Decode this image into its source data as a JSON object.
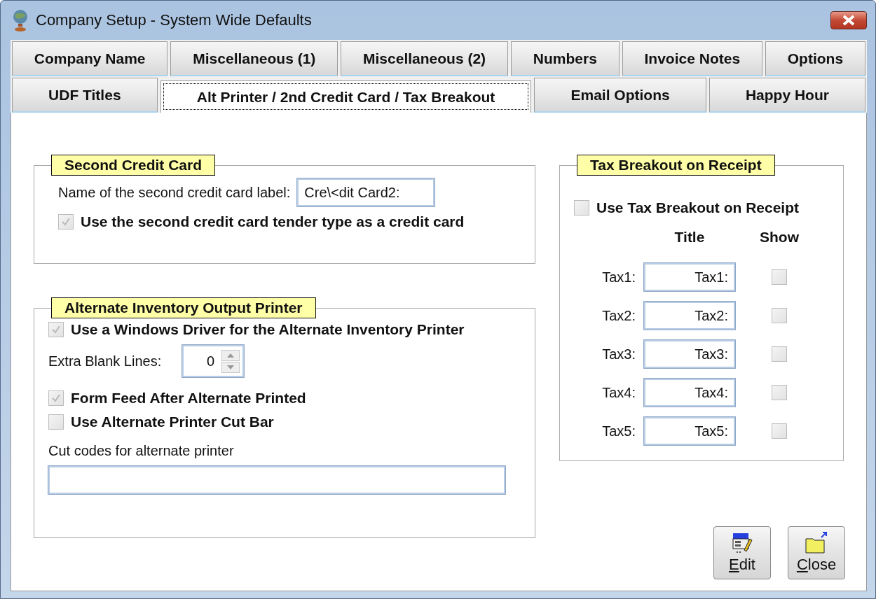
{
  "window": {
    "title": "Company Setup - System Wide Defaults"
  },
  "tab_rows": [
    {
      "tabs": [
        {
          "label": "Company Name",
          "selected": false
        },
        {
          "label": "Miscellaneous (1)",
          "selected": false
        },
        {
          "label": "Miscellaneous (2)",
          "selected": false
        },
        {
          "label": "Numbers",
          "selected": false
        },
        {
          "label": "Invoice Notes",
          "selected": false
        },
        {
          "label": "Options",
          "selected": false
        }
      ]
    },
    {
      "tabs": [
        {
          "label": "UDF Titles",
          "selected": false
        },
        {
          "label": "Alt Printer / 2nd Credit Card / Tax Breakout",
          "selected": true
        },
        {
          "label": "Email Options",
          "selected": false
        },
        {
          "label": "Happy Hour",
          "selected": false
        }
      ]
    }
  ],
  "second_credit_card": {
    "title": "Second Credit Card",
    "label_field": {
      "label": "Name of the second credit card label:",
      "value": "Cre\\<dit Card2:"
    },
    "use_as_credit": {
      "label": "Use the second credit card tender type as a credit card",
      "checked": true
    }
  },
  "alternate_printer": {
    "title": "Alternate Inventory Output Printer",
    "windows_driver": {
      "label": "Use a Windows Driver for the Alternate Inventory Printer",
      "checked": true
    },
    "extra_blank_lines": {
      "label": "Extra Blank Lines:",
      "value": "0"
    },
    "form_feed": {
      "label": "Form Feed After Alternate Printed",
      "checked": true
    },
    "cut_bar": {
      "label": "Use Alternate Printer Cut Bar",
      "checked": false
    },
    "cut_codes": {
      "label": "Cut codes for alternate printer"
    }
  },
  "tax_breakout": {
    "title": "Tax Breakout on Receipt",
    "use_breakout": {
      "label": "Use Tax Breakout on Receipt",
      "checked": false
    },
    "columns": [
      "Title",
      "Show"
    ],
    "rows": [
      {
        "label": "Tax1:",
        "title": "Tax1:",
        "show": false
      },
      {
        "label": "Tax2:",
        "title": "Tax2:",
        "show": false
      },
      {
        "label": "Tax3:",
        "title": "Tax3:",
        "show": false
      },
      {
        "label": "Tax4:",
        "title": "Tax4:",
        "show": false
      },
      {
        "label": "Tax5:",
        "title": "Tax5:",
        "show": false
      }
    ]
  },
  "buttons": [
    {
      "kind": "edit",
      "label": "Edit"
    },
    {
      "kind": "close",
      "label": "Close"
    }
  ]
}
